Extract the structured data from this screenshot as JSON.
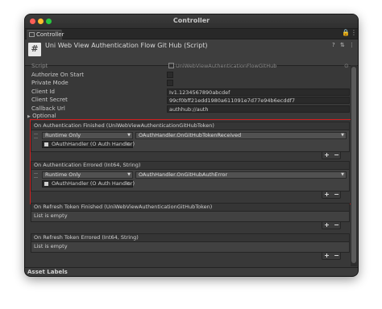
{
  "window": {
    "title": "Controller"
  },
  "tab": {
    "label": "Controller"
  },
  "component": {
    "title": "Uni Web View Authentication Flow Git Hub (Script)",
    "icon_glyph": "#",
    "help_icon": "?",
    "settings_icon": "⇅",
    "menu_icon": "⋮"
  },
  "fields": {
    "script": {
      "label": "Script",
      "value": "UniWebViewAuthenticationFlowGitHub"
    },
    "authorize_on_start": {
      "label": "Authorize On Start"
    },
    "private_mode": {
      "label": "Private Mode"
    },
    "client_id": {
      "label": "Client Id",
      "value": "Iv1.1234567890abcdef"
    },
    "client_secret": {
      "label": "Client Secret",
      "value": "99cf0bff21edd1980a611091e7d77e94b6ecddf7"
    },
    "callback_url": {
      "label": "Callback Url",
      "value": "authhub://auth"
    },
    "optional": {
      "label": "Optional"
    }
  },
  "events": {
    "finished": {
      "header": "On Authentication Finished (UniWebViewAuthenticationGitHubToken)",
      "runtime": "Runtime Only",
      "method": "OAuthHandler.OnGitHubTokenReceived",
      "object": "OAuthHandler (O Auth Handler)"
    },
    "errored": {
      "header": "On Authentication Errored (Int64, String)",
      "runtime": "Runtime Only",
      "method": "OAuthHandler.OnGitHubAuthError",
      "object": "OAuthHandler (O Auth Handler)"
    },
    "refresh_finished": {
      "header": "On Refresh Token Finished (UniWebViewAuthenticationGitHubToken)",
      "empty": "List is empty"
    },
    "refresh_errored": {
      "header": "On Refresh Token Errored (Int64, String)",
      "empty": "List is empty"
    }
  },
  "buttons": {
    "plus": "+",
    "minus": "−"
  },
  "footer": {
    "asset_labels": "Asset Labels"
  },
  "colors": {
    "highlight_border": "#d11f1f",
    "close": "#fe5f57",
    "minimize": "#febc2e",
    "maximize": "#28c840"
  }
}
